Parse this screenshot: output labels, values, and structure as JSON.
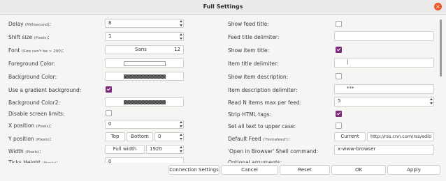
{
  "window": {
    "title": "Full Settings",
    "close_icon": "×"
  },
  "left": {
    "delay": {
      "label": "Delay",
      "unit": "(Millisecond)",
      "value": "8"
    },
    "shift": {
      "label": "Shift size",
      "unit": "(Pixels)",
      "value": "1"
    },
    "font": {
      "label": "Font",
      "unit": "(Size can't be > 200)",
      "name": "Sans",
      "size": "12"
    },
    "fg_color": {
      "label": "Foreground Color:"
    },
    "bg_color": {
      "label": "Background Color:"
    },
    "gradient": {
      "label": "Use a gradient background:",
      "checked": true
    },
    "bg_color2": {
      "label": "Background Color2:"
    },
    "disable_limits": {
      "label": "Disable screen limits:",
      "checked": false
    },
    "xpos": {
      "label": "X position",
      "unit": "(Pixels)",
      "value": "0"
    },
    "ypos": {
      "label": "Y position",
      "unit": "(Pixels)",
      "top": "Top",
      "bottom": "Bottom",
      "value": "0"
    },
    "width": {
      "label": "Width",
      "unit": "(Pixels)",
      "full": "Full width",
      "value": "1920"
    },
    "ticks": {
      "label": "Ticks Height",
      "unit": "(Pixels)",
      "value": "0"
    }
  },
  "right": {
    "show_feed_title": {
      "label": "Show feed title:",
      "checked": false
    },
    "feed_title_delim": {
      "label": "Feed title delimiter:",
      "value": ""
    },
    "show_item_title": {
      "label": "Show item title:",
      "checked": true
    },
    "item_title_delim": {
      "label": "Item title delimiter:",
      "value": "|"
    },
    "show_item_desc": {
      "label": "Show item description:",
      "checked": false
    },
    "item_desc_delim": {
      "label": "Item description delimiter:",
      "value": "***"
    },
    "read_n": {
      "label": "Read N items max per feed:",
      "value": "5"
    },
    "strip_html": {
      "label": "Strip HTML tags:",
      "checked": true
    },
    "upper": {
      "label": "Set all text to upper case:",
      "checked": false
    },
    "default_feed": {
      "label": "Default Feed",
      "unit": "('Homefeed')",
      "current": "Current",
      "url": "http://rss.cnn.com/rss/editi"
    },
    "browser": {
      "label": "'Open in Browser' Shell command:",
      "value": "x-www-browser"
    },
    "optional": {
      "label": "Optional arguments:"
    }
  },
  "footer": {
    "connection": "Connection Settings",
    "cancel": "Cancel",
    "reset": "Reset",
    "ok": "OK",
    "apply": "Apply"
  }
}
